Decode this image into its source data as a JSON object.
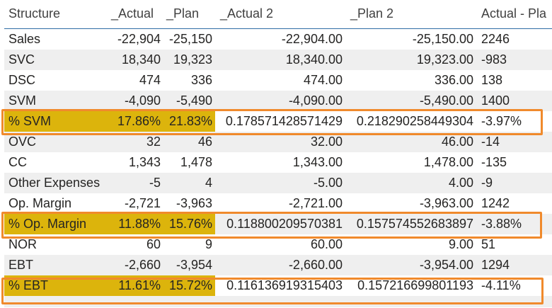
{
  "table": {
    "headers": [
      "Structure",
      "_Actual",
      "_Plan",
      "_Actual 2",
      "_Plan 2",
      "Actual - Pla"
    ],
    "rows": [
      {
        "label": "Sales",
        "actual": "-22,904",
        "plan": "-25,150",
        "actual2": "-22,904.00",
        "plan2": "-25,150.00",
        "diff": "2246",
        "highlight": false
      },
      {
        "label": "SVC",
        "actual": "18,340",
        "plan": "19,323",
        "actual2": "18,340.00",
        "plan2": "19,323.00",
        "diff": "-983",
        "highlight": false
      },
      {
        "label": "DSC",
        "actual": "474",
        "plan": "336",
        "actual2": "474.00",
        "plan2": "336.00",
        "diff": "138",
        "highlight": false
      },
      {
        "label": "SVM",
        "actual": "-4,090",
        "plan": "-5,490",
        "actual2": "-4,090.00",
        "plan2": "-5,490.00",
        "diff": "1400",
        "highlight": false
      },
      {
        "label": "% SVM",
        "actual": "17.86%",
        "plan": "21.83%",
        "actual2": "0.178571428571429",
        "plan2": "0.218290258449304",
        "diff": "-3.97%",
        "highlight": true
      },
      {
        "label": "OVC",
        "actual": "32",
        "plan": "46",
        "actual2": "32.00",
        "plan2": "46.00",
        "diff": "-14",
        "highlight": false
      },
      {
        "label": "CC",
        "actual": "1,343",
        "plan": "1,478",
        "actual2": "1,343.00",
        "plan2": "1,478.00",
        "diff": "-135",
        "highlight": false
      },
      {
        "label": "Other Expenses",
        "actual": "-5",
        "plan": "4",
        "actual2": "-5.00",
        "plan2": "4.00",
        "diff": "-9",
        "highlight": false
      },
      {
        "label": "Op. Margin",
        "actual": "-2,721",
        "plan": "-3,963",
        "actual2": "-2,721.00",
        "plan2": "-3,963.00",
        "diff": "1242",
        "highlight": false
      },
      {
        "label": "% Op. Margin",
        "actual": "11.88%",
        "plan": "15.76%",
        "actual2": "0.118800209570381",
        "plan2": "0.157574552683897",
        "diff": "-3.88%",
        "highlight": true
      },
      {
        "label": "NOR",
        "actual": "60",
        "plan": "9",
        "actual2": "60.00",
        "plan2": "9.00",
        "diff": "51",
        "highlight": false
      },
      {
        "label": "EBT",
        "actual": "-2,660",
        "plan": "-3,954",
        "actual2": "-2,660.00",
        "plan2": "-3,954.00",
        "diff": "1294",
        "highlight": false
      },
      {
        "label": "% EBT",
        "actual": "11.61%",
        "plan": "15.72%",
        "actual2": "0.116136919315403",
        "plan2": "0.157216699801193",
        "diff": "-4.11%",
        "highlight": true
      }
    ]
  },
  "colors": {
    "highlight_fill": "#dcb40c",
    "highlight_border": "#f08a2c",
    "header_rule": "#2f6ea6",
    "alt_row": "#efefef"
  }
}
